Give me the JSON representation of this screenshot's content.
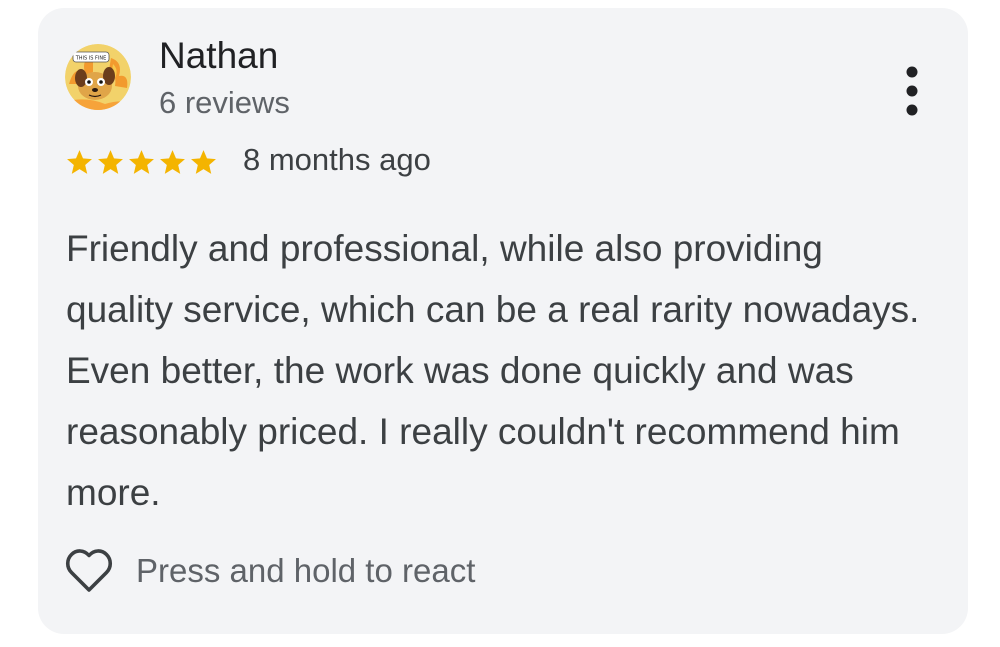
{
  "review": {
    "author": {
      "name": "Nathan",
      "review_count": "6 reviews",
      "avatar_caption": "THIS IS FINE"
    },
    "rating": 5,
    "rating_max": 5,
    "date": "8 months ago",
    "text": "Friendly and professional, while also providing quality service, which can be a real rarity nowadays. Even better, the work was done quickly and was reasonably priced. I really couldn't recommend him more.",
    "react_prompt": "Press and hold to react",
    "icons": {
      "menu": "more-vert-icon",
      "star": "star-icon",
      "react": "heart-outline-icon"
    }
  },
  "colors": {
    "card_background": "#f3f4f6",
    "star": "#f4b400",
    "name": "#202124",
    "body_text": "#3c4043",
    "secondary_text": "#5f6368"
  }
}
